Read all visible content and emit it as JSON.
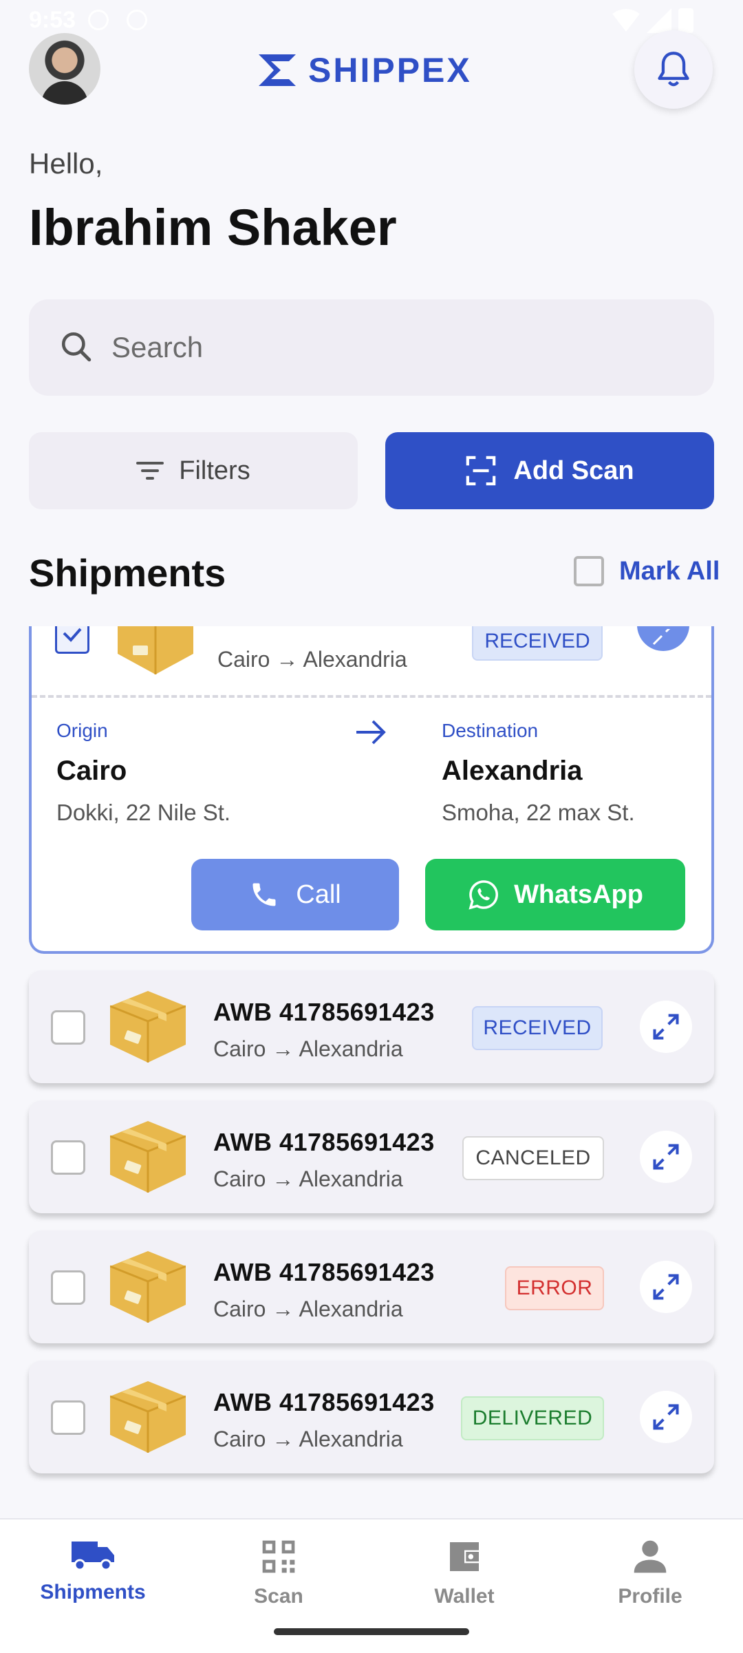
{
  "status_bar": {
    "time": "9:53"
  },
  "header": {
    "brand": "SHIPPEX"
  },
  "greeting": {
    "hello": "Hello,",
    "name": "Ibrahim Shaker"
  },
  "search": {
    "placeholder": "Search"
  },
  "actions": {
    "filters": "Filters",
    "add_scan": "Add Scan"
  },
  "section": {
    "title": "Shipments",
    "mark_all": "Mark All"
  },
  "expanded_shipment": {
    "route": "Cairo → Alexandria",
    "status": "RECEIVED",
    "origin_label": "Origin",
    "origin_city": "Cairo",
    "origin_address": "Dokki, 22 Nile St.",
    "destination_label": "Destination",
    "destination_city": "Alexandria",
    "destination_address": "Smoha, 22 max St.",
    "call": "Call",
    "whatsapp": "WhatsApp"
  },
  "shipments": [
    {
      "awb": "AWB 41785691423",
      "route": "Cairo → Alexandria",
      "status": "RECEIVED"
    },
    {
      "awb": "AWB 41785691423",
      "route": "Cairo → Alexandria",
      "status": "CANCELED"
    },
    {
      "awb": "AWB 41785691423",
      "route": "Cairo → Alexandria",
      "status": "ERROR"
    },
    {
      "awb": "AWB 41785691423",
      "route": "Cairo → Alexandria",
      "status": "DELIVERED"
    }
  ],
  "nav": {
    "shipments": "Shipments",
    "scan": "Scan",
    "wallet": "Wallet",
    "profile": "Profile"
  },
  "colors": {
    "primary": "#2f50c6",
    "whatsapp": "#22c55e",
    "call": "#6e8ee8"
  }
}
